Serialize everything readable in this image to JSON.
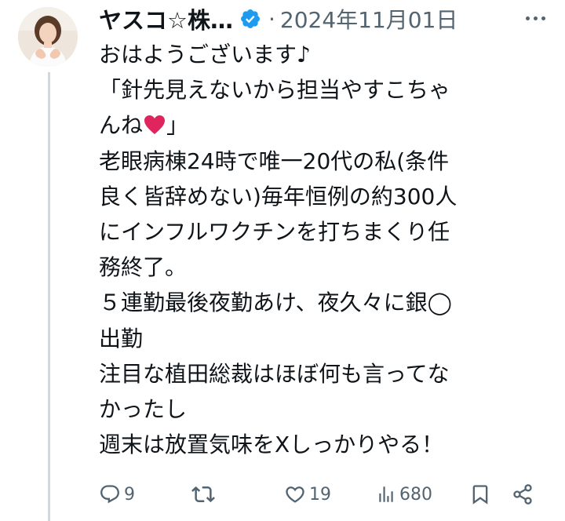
{
  "post": {
    "author": {
      "display_name": "ヤスコ☆株…",
      "verified": true
    },
    "separator": "·",
    "date": "2024年11月01日",
    "body_lines": [
      "おはようございます♪",
      "「針先見えないから担当やすこちゃ",
      "んね",
      "老眼病棟24時で唯一20代の私(条件",
      "良く皆辞めない)毎年恒例の約300人",
      "にインフルワクチンを打ちまくり任",
      "務終了。",
      "５連勤最後夜勤あけ、夜久々に銀◯",
      "出勤",
      "注目な植田総裁はほぼ何も言ってな",
      "かったし",
      "週末は放置気味をXしっかりやる！"
    ],
    "line3_suffix": "」",
    "actions": {
      "replies": "9",
      "reposts": "",
      "likes": "19",
      "views": "680"
    }
  },
  "colors": {
    "text": "#0f1419",
    "secondary": "#536471",
    "verified_badge": "#1d9bf0",
    "heart_emoji": "#e0245e",
    "thread_line": "#cfd9de"
  },
  "icons": {
    "verified": "verified-badge-icon",
    "more": "more-options-icon",
    "reply": "reply-icon",
    "repost": "repost-icon",
    "like": "like-icon",
    "views": "views-icon",
    "bookmark": "bookmark-icon",
    "share": "share-icon",
    "emoji": "red-heart-emoji-icon"
  }
}
